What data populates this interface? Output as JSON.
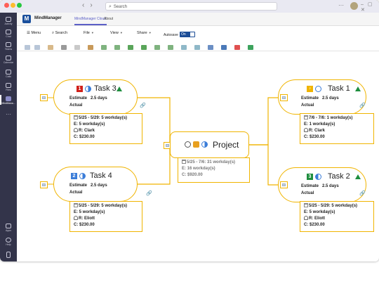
{
  "titlebar": {
    "search_placeholder": "Search",
    "more": "···",
    "window_controls": "– ▢ ✕"
  },
  "rail": {
    "items": [
      {
        "label": "Activity",
        "icon": "bell-icon"
      },
      {
        "label": "Chat",
        "icon": "chat-icon"
      },
      {
        "label": "Teams",
        "icon": "teams-icon"
      },
      {
        "label": "Calendar",
        "icon": "calendar-icon"
      },
      {
        "label": "Calls",
        "icon": "phone-icon"
      },
      {
        "label": "Files",
        "icon": "files-icon"
      },
      {
        "label": "MindMana...",
        "icon": "mindmanager-icon"
      },
      {
        "label": "···",
        "icon": "more-icon"
      }
    ],
    "bottom": [
      {
        "label": "Apps",
        "icon": "apps-icon"
      },
      {
        "label": "Help",
        "icon": "help-icon"
      }
    ]
  },
  "app": {
    "title": "MindManager",
    "tabs": [
      "MindManager Cloud",
      "About"
    ]
  },
  "ribbon": {
    "menu": "Menu",
    "search": "Search",
    "file": "File",
    "view": "View",
    "share": "Share",
    "autosave_label": "Autosave",
    "autosave_state": "On"
  },
  "map": {
    "central": {
      "title": "Project",
      "dates": "5/25 - 7/6: 31 workday(s)",
      "effort": "E: 16 workday(s)",
      "cost": "C: $920.00"
    },
    "tasks": [
      {
        "name": "Task 3",
        "priority": "1",
        "priority_color": "#d0201a",
        "estimate_label": "Estimate",
        "estimate": "2.5 days",
        "actual_label": "Actual",
        "dates": "5/25 - 5/29: 5 workday(s)",
        "effort": "E: 5 workday(s)",
        "resource": "R: Clark",
        "cost": "C: $230.00"
      },
      {
        "name": "Task 4",
        "priority": "2",
        "priority_color": "#3b7dd8",
        "estimate_label": "Estimate",
        "estimate": "2.5 days",
        "actual_label": "Actual",
        "dates": "5/25 - 5/29: 5 workday(s)",
        "effort": "E: 5 workday(s)",
        "resource": "R: Eliott",
        "cost": "C: $230.00"
      },
      {
        "name": "Task 1",
        "priority": "♪",
        "priority_color": "#f0b400",
        "estimate_label": "Estimate",
        "estimate": "2.5 days",
        "actual_label": "Actual",
        "dates": "7/6 - 7/6: 1 workday(s)",
        "effort": "E: 1 workday(s)",
        "resource": "R: Clark",
        "cost": "C: $230.00"
      },
      {
        "name": "Task 2",
        "priority": "3",
        "priority_color": "#1e8e3e",
        "estimate_label": "Estimate",
        "estimate": "2.5 days",
        "actual_label": "Actual",
        "dates": "5/25 - 5/29: 5 workday(s)",
        "effort": "E: 5 workday(s)",
        "resource": "R: Eliott",
        "cost": "C: $230.00"
      }
    ]
  }
}
